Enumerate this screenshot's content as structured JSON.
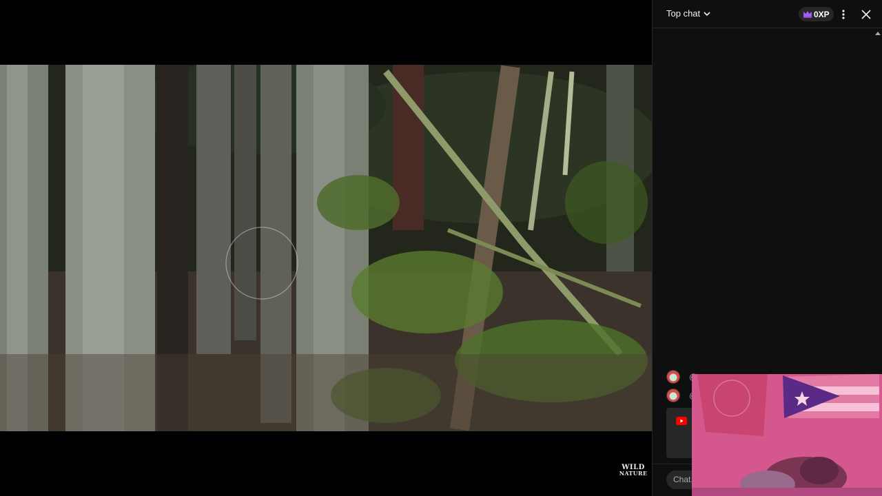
{
  "chat": {
    "mode_label": "Top chat",
    "xp_badge": "0XP",
    "messages": [
      {
        "prefix": "@"
      },
      {
        "prefix": "@"
      }
    ],
    "input_placeholder": "Chat..."
  },
  "video": {
    "watermark_line1": "WILD",
    "watermark_line2": "NATURE"
  },
  "icons": {
    "chevron": "chevron-down-icon",
    "crown": "crown-icon",
    "more": "more-vert-icon",
    "close": "close-icon",
    "youtube": "youtube-icon",
    "avatar": "avatar-icon"
  },
  "colors": {
    "panel_bg": "#0f0f0f",
    "badge_bg": "#272727",
    "crown_purple": "#a55cf1",
    "youtube_red": "#ff0000",
    "webcam_pink": "#e572a7"
  }
}
